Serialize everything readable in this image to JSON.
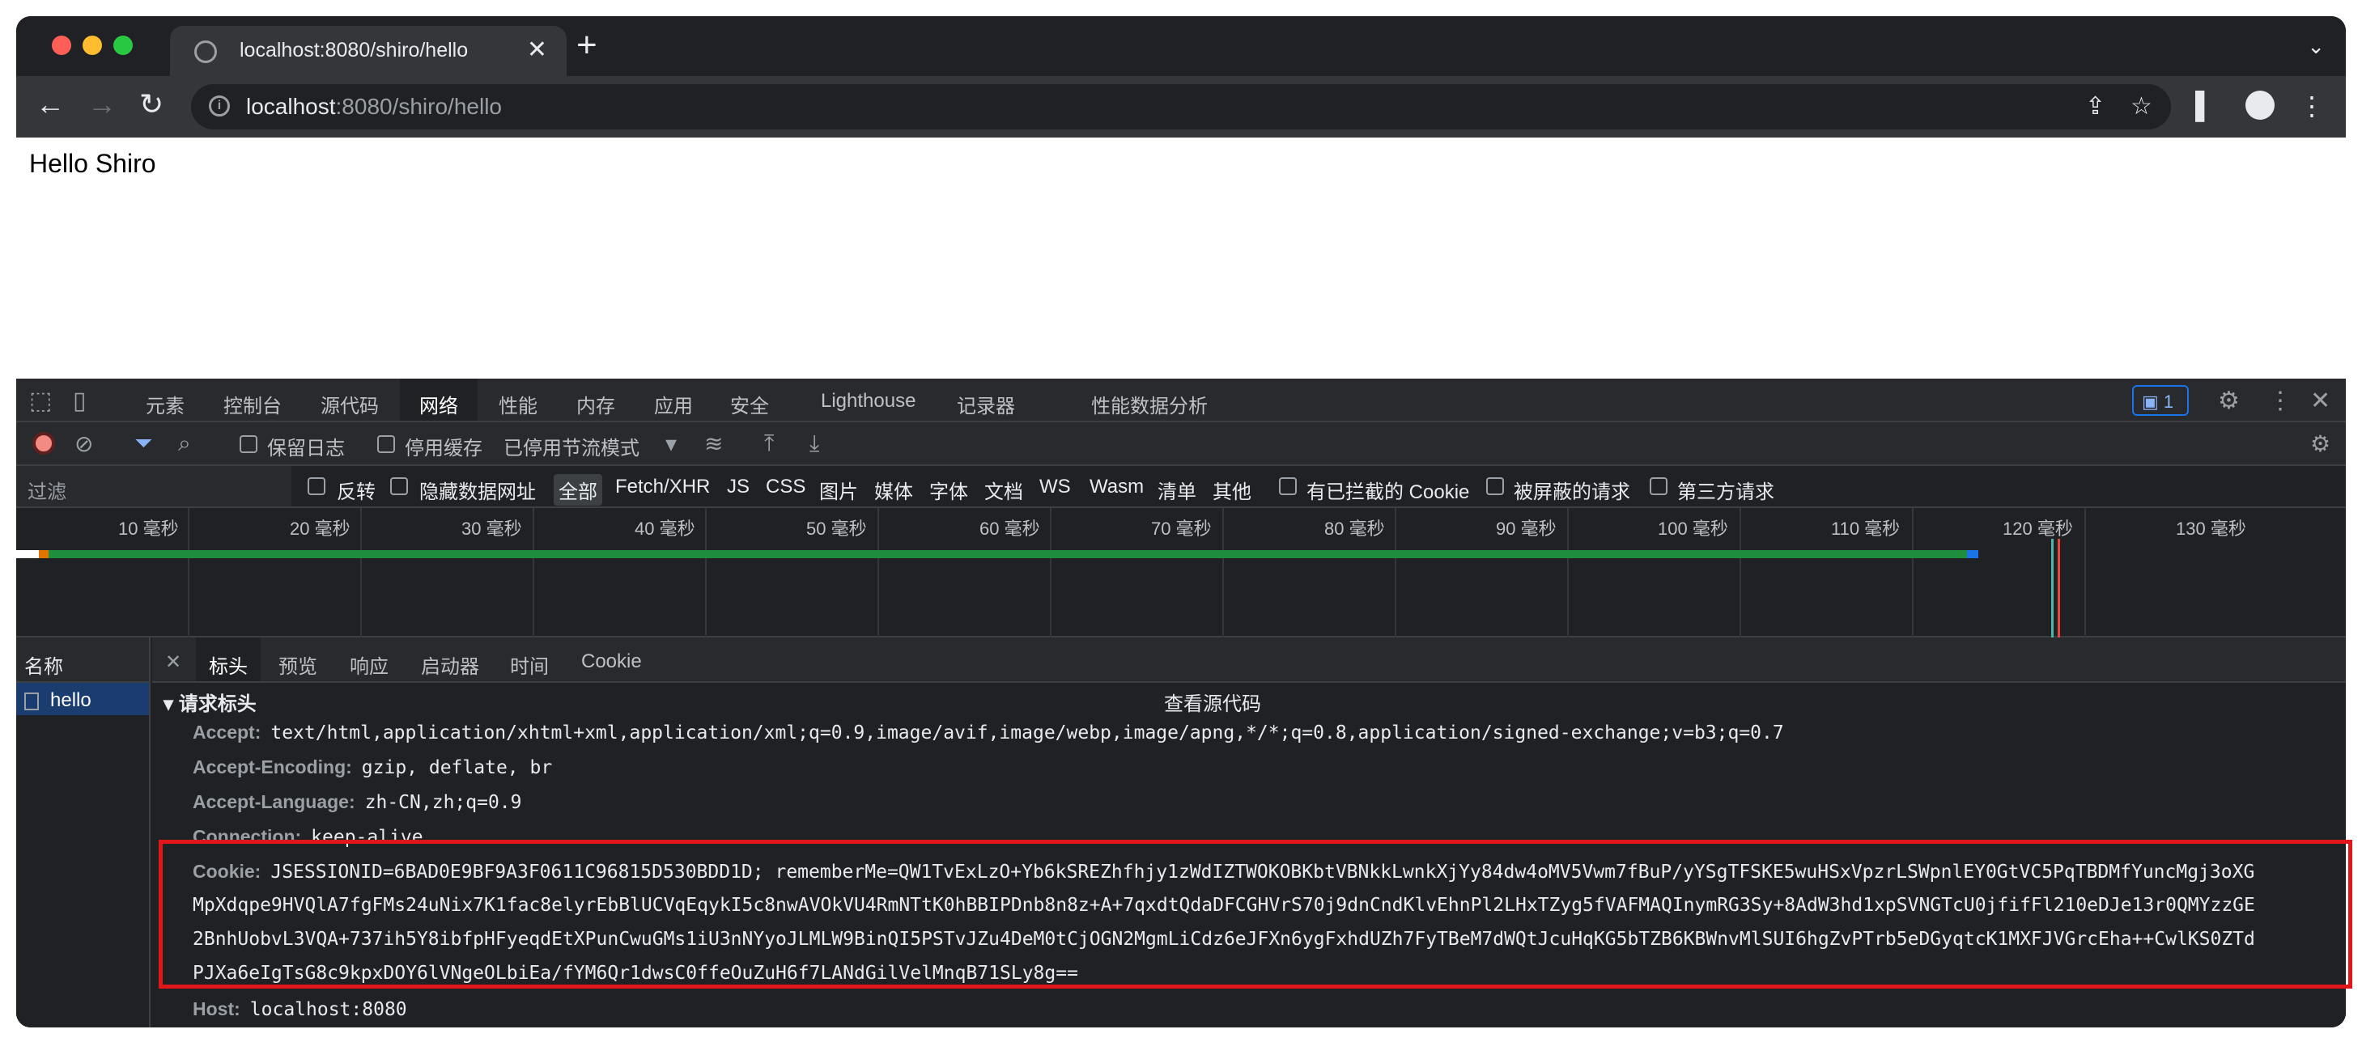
{
  "browser": {
    "tab_title": "localhost:8080/shiro/hello",
    "url_host": "localhost",
    "url_rest": ":8080/shiro/hello"
  },
  "page": {
    "body_text": "Hello Shiro"
  },
  "devtools": {
    "tabs": [
      "元素",
      "控制台",
      "源代码",
      "网络",
      "性能",
      "内存",
      "应用",
      "安全",
      "Lighthouse",
      "记录器",
      "性能数据分析"
    ],
    "issues_count": "1",
    "network_toolbar": {
      "preserve_log": "保留日志",
      "disable_cache": "停用缓存",
      "throttling": "已停用节流模式"
    },
    "filter": {
      "placeholder": "过滤",
      "invert": "反转",
      "hide_data_urls": "隐藏数据网址",
      "types": [
        "全部",
        "Fetch/XHR",
        "JS",
        "CSS",
        "图片",
        "媒体",
        "字体",
        "文档",
        "WS",
        "Wasm",
        "清单",
        "其他"
      ],
      "blocked_cookies": "有已拦截的 Cookie",
      "blocked_requests": "被屏蔽的请求",
      "third_party": "第三方请求"
    },
    "timeline_ticks": [
      "10 毫秒",
      "20 毫秒",
      "30 毫秒",
      "40 毫秒",
      "50 毫秒",
      "60 毫秒",
      "70 毫秒",
      "80 毫秒",
      "90 毫秒",
      "100 毫秒",
      "110 毫秒",
      "120 毫秒",
      "130 毫秒"
    ],
    "requests": {
      "header": "名称",
      "items": [
        "hello"
      ]
    },
    "detail_tabs": [
      "标头",
      "预览",
      "响应",
      "启动器",
      "时间",
      "Cookie"
    ],
    "section_title": "请求标头",
    "view_source": "查看源代码",
    "headers": [
      {
        "key": "Accept:",
        "value": "text/html,application/xhtml+xml,application/xml;q=0.9,image/avif,image/webp,image/apng,*/*;q=0.8,application/signed-exchange;v=b3;q=0.7"
      },
      {
        "key": "Accept-Encoding:",
        "value": "gzip, deflate, br"
      },
      {
        "key": "Accept-Language:",
        "value": "zh-CN,zh;q=0.9"
      },
      {
        "key": "Connection:",
        "value": "keep-alive"
      }
    ],
    "cookie": {
      "key": "Cookie:",
      "lines": [
        "JSESSIONID=6BAD0E9BF9A3F0611C96815D530BDD1D; rememberMe=QW1TvExLzO+Yb6kSREZhfhjy1zWdIZTWOKOBKbtVBNkkLwnkXjYy84dw4oMV5Vwm7fBuP/yYSgTFSKE5wuHSxVpzrLSWpnlEY0GtVC5PqTBDMfYuncMgj3oXG",
        "MpXdqpe9HVQlA7fgFMs24uNix7K1fac8elyrEbBlUCVqEqykI5c8nwAVOkVU4RmNTtK0hBBIPDnb8n8z+A+7qxdtQdaDFCGHVrS70j9dnCndKlvEhnPl2LHxTZyg5fVAFMAQInymRG3Sy+8AdW3hd1xpSVNGTcU0jfifFl210eDJe13r0QMYzzGE",
        "2BnhUobvL3VQA+737ih5Y8ibfpHFyeqdEtXPunCwuGMs1iU3nNYyoJLMLW9BinQI5PSTvJZu4DeM0tCjOGN2MgmLiCdz6eJFXn6ygFxhdUZh7FyTBeM7dWQtJcuHqKG5bTZB6KBWnvMlSUI6hgZvPTrb5eDGyqtcK1MXFJVGrcEha++CwlKS0ZTd",
        "PJXa6eIgTsG8c9kpxDOY6lVNgeOLbiEa/fYM6Qr1dwsC0ffeOuZuH6f7LANdGilVelMnqB71SLy8g=="
      ]
    },
    "host_header": {
      "key": "Host:",
      "value": "localhost:8080"
    }
  },
  "colors": {
    "highlight": "#e0161b",
    "timeline_bar": "#1e8e3e",
    "accent": "#1a73e8"
  }
}
